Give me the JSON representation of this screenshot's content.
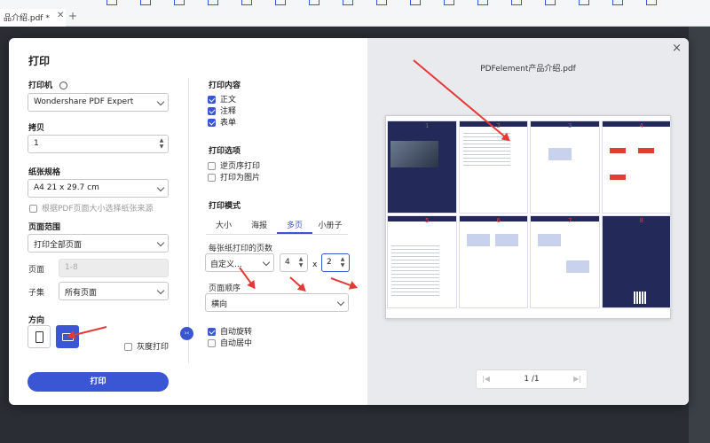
{
  "app": {
    "tab_title": "品介绍.pdf *",
    "tab_close": "✕",
    "tab_add": "+"
  },
  "dialog": {
    "title": "打印",
    "close": "×",
    "printer": {
      "label": "打印机",
      "value": "Wondershare PDF Expert"
    },
    "copies": {
      "label": "拷贝",
      "value": "1"
    },
    "paper": {
      "label": "纸张规格",
      "value": "A4 21 x 29.7 cm",
      "auto_source_label": "根据PDF页面大小选择纸张来源"
    },
    "range": {
      "label": "页面范围",
      "value": "打印全部页面",
      "pages_label": "页面",
      "pages_placeholder": "1-8",
      "subset_label": "子集",
      "subset_value": "所有页面"
    },
    "orientation": {
      "label": "方向",
      "grayscale_label": "灰度打印"
    },
    "print_button": "打印",
    "content": {
      "label": "打印内容",
      "items": [
        {
          "label": "正文",
          "checked": true
        },
        {
          "label": "注释",
          "checked": true
        },
        {
          "label": "表单",
          "checked": true
        }
      ]
    },
    "options": {
      "label": "打印选项",
      "items": [
        {
          "label": "逆页序打印",
          "checked": false
        },
        {
          "label": "打印为图片",
          "checked": false
        }
      ]
    },
    "mode": {
      "label": "打印模式",
      "tabs": [
        "大小",
        "海报",
        "多页",
        "小册子"
      ],
      "active_tab": "多页",
      "pages_per_sheet_label": "每张纸打印的页数",
      "pages_per_sheet_value": "自定义...",
      "cols": "4",
      "times": "x",
      "rows": "2",
      "order_label": "页面顺序",
      "order_value": "横向",
      "auto_rotate": "自动旋转",
      "auto_center": "自动居中"
    },
    "preview": {
      "filename": "PDFelement产品介绍.pdf",
      "page_numbers": [
        "1",
        "2",
        "3",
        "4",
        "5",
        "6",
        "7",
        "8"
      ],
      "pager": "1 /1"
    }
  },
  "colors": {
    "accent": "#3a56d4",
    "annotation": "#e53935"
  }
}
